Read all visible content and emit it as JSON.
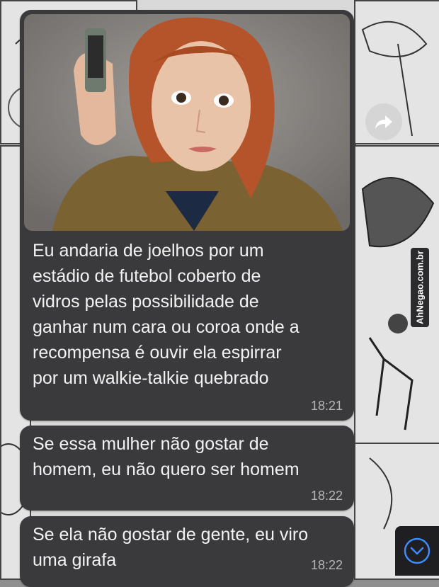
{
  "chat": {
    "messages": [
      {
        "has_photo": true,
        "text": "Eu andaria de joelhos por um\nestádio de futebol coberto de\nvidros pelas possibilidade de\nganhar num cara ou coroa onde a\nrecompensa é ouvir ela espirrar\npor um walkie-talkie quebrado",
        "time": "18:21"
      },
      {
        "text": "Se essa mulher não gostar de\nhomem, eu não quero ser homem",
        "time": "18:22"
      },
      {
        "text": "Se ela não gostar de gente, eu viro\numa girafa",
        "time": "18:22"
      }
    ]
  },
  "watermark": {
    "text": "AhNegao.com.br"
  },
  "icons": {
    "forward": "forward-arrow-icon",
    "scroll_down": "chevron-down-circle-icon"
  },
  "colors": {
    "bubble": "#3a3a3c",
    "text": "#f2f2f2",
    "time": "#b5b5b8",
    "accent": "#3c8cff"
  }
}
